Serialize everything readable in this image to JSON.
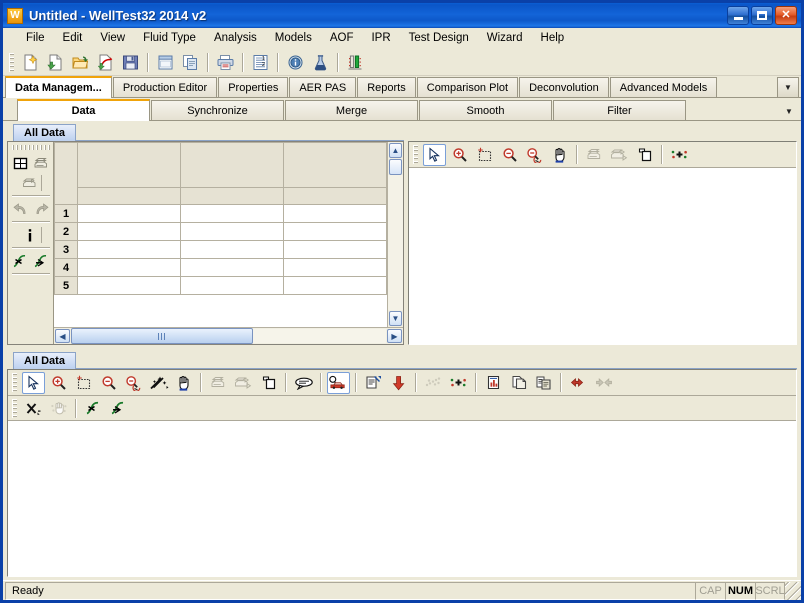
{
  "window": {
    "title": "Untitled - WellTest32 2014 v2",
    "app_icon": "W",
    "buttons": {
      "minimize": "minimize-icon",
      "maximize": "maximize-icon",
      "close": "close-icon"
    }
  },
  "menu": {
    "items": [
      "File",
      "Edit",
      "View",
      "Fluid Type",
      "Analysis",
      "Models",
      "AOF",
      "IPR",
      "Test Design",
      "Wizard",
      "Help"
    ]
  },
  "toolbar": {
    "buttons": [
      {
        "name": "new-icon",
        "group": 1
      },
      {
        "name": "open-recent-icon",
        "group": 1
      },
      {
        "name": "open-folder-icon",
        "group": 1
      },
      {
        "name": "import-icon",
        "group": 1
      },
      {
        "name": "save-icon",
        "group": 1
      },
      {
        "name": "window-icon",
        "group": 2
      },
      {
        "name": "copy-icon",
        "group": 2
      },
      {
        "name": "print-icon",
        "group": 3
      },
      {
        "name": "report-icon",
        "group": 4
      },
      {
        "name": "info-icon",
        "group": 5
      },
      {
        "name": "fluid-icon",
        "group": 5
      },
      {
        "name": "chart-icon",
        "group": 6
      }
    ]
  },
  "tabs_primary": {
    "items": [
      {
        "label": "Data Managem...",
        "active": true
      },
      {
        "label": "Production Editor",
        "active": false
      },
      {
        "label": "Properties",
        "active": false
      },
      {
        "label": "AER PAS",
        "active": false
      },
      {
        "label": "Reports",
        "active": false
      },
      {
        "label": "Comparison Plot",
        "active": false
      },
      {
        "label": "Deconvolution",
        "active": false
      },
      {
        "label": "Advanced Models",
        "active": false
      }
    ],
    "overflow": "chevron-down-icon"
  },
  "tabs_secondary": {
    "items": [
      {
        "label": "Data",
        "active": true
      },
      {
        "label": "Synchronize",
        "active": false
      },
      {
        "label": "Merge",
        "active": false
      },
      {
        "label": "Smooth",
        "active": false
      },
      {
        "label": "Filter",
        "active": false
      }
    ],
    "overflow": "chevron-down-icon"
  },
  "data_panel": {
    "doc_tab": "All Data",
    "side_tools": [
      "table-grid-icon",
      "print-stack-icon",
      "print-stack-alt-icon",
      "undo-icon",
      "redo-icon",
      "info-icon",
      "curve-fit-icon",
      "curve-fit-alt-icon"
    ],
    "grid": {
      "columns": [
        "",
        "",
        ""
      ],
      "subheaders": [
        "",
        "",
        ""
      ],
      "rows": [
        {
          "num": "1",
          "cells": [
            "",
            "",
            ""
          ]
        },
        {
          "num": "2",
          "cells": [
            "",
            "",
            ""
          ]
        },
        {
          "num": "3",
          "cells": [
            "",
            "",
            ""
          ]
        },
        {
          "num": "4",
          "cells": [
            "",
            "",
            ""
          ]
        },
        {
          "num": "5",
          "cells": [
            "",
            "",
            ""
          ]
        }
      ]
    },
    "scroll": {
      "up": "scroll-up-icon",
      "down": "scroll-down-icon",
      "left": "scroll-left-icon",
      "right": "scroll-right-icon"
    }
  },
  "plot_panel_top": {
    "tools": [
      {
        "name": "pointer-icon",
        "pressed": true,
        "enabled": true
      },
      {
        "name": "zoom-in-icon",
        "pressed": false,
        "enabled": true
      },
      {
        "name": "zoom-box-icon",
        "pressed": false,
        "enabled": true
      },
      {
        "name": "zoom-out-icon",
        "pressed": false,
        "enabled": true
      },
      {
        "name": "zoom-reset-icon",
        "pressed": false,
        "enabled": true
      },
      {
        "name": "pan-hand-icon",
        "pressed": false,
        "enabled": true
      },
      {
        "name": "print-icon",
        "pressed": false,
        "enabled": false
      },
      {
        "name": "print-preview-icon",
        "pressed": false,
        "enabled": false
      },
      {
        "name": "copy-page-icon",
        "pressed": false,
        "enabled": true
      },
      {
        "name": "scatter-settings-icon",
        "pressed": false,
        "enabled": true
      }
    ]
  },
  "plot_panel_bottom": {
    "doc_tab": "All Data",
    "tools_row1": [
      {
        "name": "pointer-icon",
        "pressed": true,
        "enabled": true
      },
      {
        "name": "zoom-in-icon",
        "pressed": false,
        "enabled": true
      },
      {
        "name": "zoom-box-icon",
        "pressed": false,
        "enabled": true
      },
      {
        "name": "zoom-out-icon",
        "pressed": false,
        "enabled": true
      },
      {
        "name": "zoom-reset-icon",
        "pressed": false,
        "enabled": true
      },
      {
        "name": "wand-tools-icon",
        "pressed": false,
        "enabled": true
      },
      {
        "name": "pan-hand-icon",
        "pressed": false,
        "enabled": true
      },
      {
        "name": "print-icon",
        "pressed": false,
        "enabled": false
      },
      {
        "name": "print-preview-icon",
        "pressed": false,
        "enabled": false
      },
      {
        "name": "copy-page-icon",
        "pressed": false,
        "enabled": true
      },
      {
        "name": "annotation-icon",
        "pressed": false,
        "enabled": true
      },
      {
        "name": "plot-select-icon",
        "pressed": true,
        "enabled": true
      },
      {
        "name": "edit-properties-icon",
        "pressed": false,
        "enabled": true
      },
      {
        "name": "down-arrow-icon",
        "pressed": false,
        "enabled": true
      },
      {
        "name": "scatter-dots-icon",
        "pressed": false,
        "enabled": false
      },
      {
        "name": "scatter-settings-icon",
        "pressed": false,
        "enabled": true
      },
      {
        "name": "bar-chart-doc-icon",
        "pressed": false,
        "enabled": true
      },
      {
        "name": "copy-doc-icon",
        "pressed": false,
        "enabled": true
      },
      {
        "name": "paste-doc-icon",
        "pressed": false,
        "enabled": true
      },
      {
        "name": "collapse-icon",
        "pressed": false,
        "enabled": true
      },
      {
        "name": "expand-icon",
        "pressed": false,
        "enabled": false
      }
    ],
    "tools_row2": [
      {
        "name": "delete-point-icon",
        "pressed": false,
        "enabled": true
      },
      {
        "name": "hand-points-icon",
        "pressed": false,
        "enabled": false
      },
      {
        "name": "curve-fit-icon",
        "pressed": false,
        "enabled": true
      },
      {
        "name": "curve-fit-alt-icon",
        "pressed": false,
        "enabled": true
      }
    ]
  },
  "statusbar": {
    "message": "Ready",
    "indicators": [
      {
        "label": "CAP",
        "active": false
      },
      {
        "label": "NUM",
        "active": true
      },
      {
        "label": "SCRL",
        "active": false
      }
    ]
  },
  "colors": {
    "titlebar_blue": "#0b5fd4",
    "window_border": "#0a40a8",
    "chrome": "#ece9d8",
    "tab_active_accent": "#f0a30a",
    "grid_header": "#e6e2d3",
    "canvas": "#ffffff"
  }
}
